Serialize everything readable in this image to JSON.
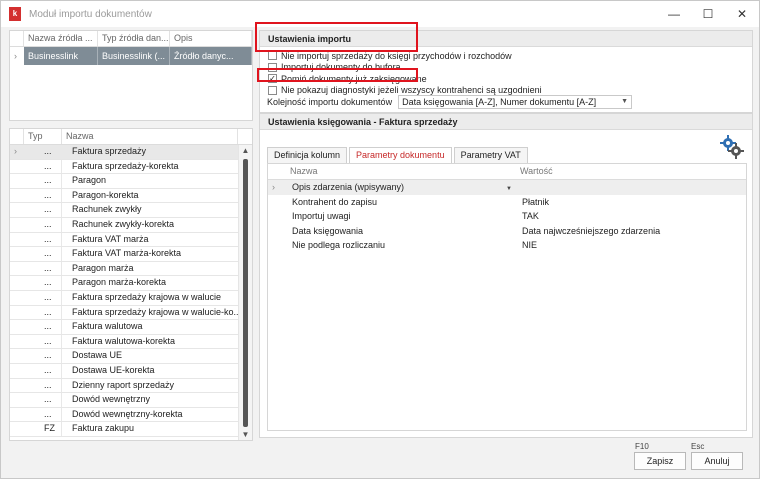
{
  "window": {
    "title": "Moduł importu dokumentów",
    "logo_letter": "k",
    "controls": {
      "minimize": "—",
      "maximize": "☐",
      "close": "✕"
    }
  },
  "sources": {
    "columns": [
      "Nazwa źródła ...",
      "Typ źródła dan...",
      "Opis"
    ],
    "rows": [
      {
        "name": "Businesslink",
        "type": "Businesslink (...",
        "desc": "Źródło danyc..."
      }
    ]
  },
  "documents": {
    "columns": [
      "Typ",
      "Nazwa"
    ],
    "rows": [
      {
        "typ": "...",
        "name": "Faktura sprzedaży"
      },
      {
        "typ": "...",
        "name": "Faktura sprzedaży-korekta"
      },
      {
        "typ": "...",
        "name": "Paragon"
      },
      {
        "typ": "...",
        "name": "Paragon-korekta"
      },
      {
        "typ": "...",
        "name": "Rachunek zwykły"
      },
      {
        "typ": "...",
        "name": "Rachunek zwykły-korekta"
      },
      {
        "typ": "...",
        "name": "Faktura VAT marża"
      },
      {
        "typ": "...",
        "name": "Faktura VAT marża-korekta"
      },
      {
        "typ": "...",
        "name": "Paragon marża"
      },
      {
        "typ": "...",
        "name": "Paragon marża-korekta"
      },
      {
        "typ": "...",
        "name": "Faktura sprzedaży krajowa w walucie"
      },
      {
        "typ": "...",
        "name": "Faktura sprzedaży krajowa w walucie-ko..."
      },
      {
        "typ": "...",
        "name": "Faktura walutowa"
      },
      {
        "typ": "...",
        "name": "Faktura walutowa-korekta"
      },
      {
        "typ": "...",
        "name": "Dostawa UE"
      },
      {
        "typ": "...",
        "name": "Dostawa UE-korekta"
      },
      {
        "typ": "...",
        "name": "Dzienny raport sprzedaży"
      },
      {
        "typ": "...",
        "name": "Dowód wewnętrzny"
      },
      {
        "typ": "...",
        "name": "Dowód wewnętrzny-korekta"
      },
      {
        "typ": "FZ",
        "name": "Faktura zakupu"
      }
    ]
  },
  "import_settings": {
    "header": "Ustawienia importu",
    "options": [
      {
        "label": "Nie importuj sprzedaży do księgi przychodów i rozchodów",
        "checked": false
      },
      {
        "label": "Importuj dokumenty do bufora",
        "checked": false
      },
      {
        "label": "Pomiń dokumenty już zaksięgowane",
        "checked": true
      },
      {
        "label": "Nie pokazuj diagnostyki jeżeli wszyscy kontrahenci są uzgodnieni",
        "checked": false
      }
    ],
    "order_label": "Kolejność importu dokumentów",
    "order_value": "Data księgowania [A-Z], Numer dokumentu [A-Z]"
  },
  "booking_settings": {
    "header": "Ustawienia księgowania - Faktura sprzedaży",
    "tabs": [
      "Definicja kolumn",
      "Parametry dokumentu",
      "Parametry VAT"
    ],
    "active_tab": 1,
    "grid_columns": [
      "Nazwa",
      "Wartość"
    ],
    "rows": [
      {
        "name": "Opis zdarzenia (wpisywany)",
        "value": ""
      },
      {
        "name": "Kontrahent do zapisu",
        "value": "Płatnik"
      },
      {
        "name": "Importuj uwagi",
        "value": "TAK"
      },
      {
        "name": "Data księgowania",
        "value": "Data najwcześniejszego zdarzenia"
      },
      {
        "name": "Nie podlega rozliczaniu",
        "value": "NIE"
      }
    ]
  },
  "footer": {
    "save_key": "F10",
    "save_label": "Zapisz",
    "cancel_key": "Esc",
    "cancel_label": "Anuluj"
  },
  "colors": {
    "accent_red": "#e0141e",
    "selection_gray": "#7f8c96",
    "gear_blue": "#2f6fb3"
  }
}
